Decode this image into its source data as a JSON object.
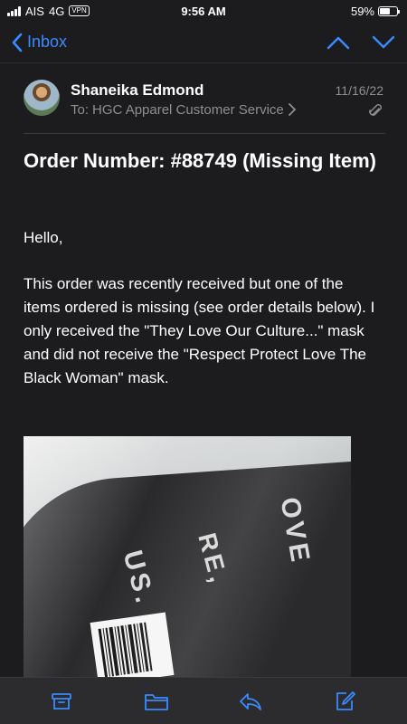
{
  "status_bar": {
    "carrier": "AIS",
    "network": "4G",
    "vpn": "VPN",
    "time": "9:56 AM",
    "battery_percent": "59%",
    "battery_level": 0.59
  },
  "nav": {
    "back_label": "Inbox",
    "back_icon": "chevron-left-icon",
    "prev_icon": "chevron-up-icon",
    "next_icon": "chevron-down-icon"
  },
  "message": {
    "sender": "Shaneika Edmond",
    "date": "11/16/22",
    "to_prefix": "To:",
    "to": "HGC Apparel Customer Service",
    "subject": "Order Number: #88749 (Missing Item)",
    "greeting": "Hello,",
    "body": "This order was recently received but one of the items ordered is missing (see order details below). I only received the \"They Love Our Culture...\" mask and did not receive the \"Respect Protect Love The Black Woman\" mask."
  },
  "toolbar": {
    "archive_icon": "archive-icon",
    "move_icon": "folder-icon",
    "reply_icon": "reply-icon",
    "compose_icon": "compose-icon"
  },
  "colors": {
    "accent": "#3a8bff",
    "background": "#1c1c1e",
    "secondary_text": "#8e8e93"
  }
}
